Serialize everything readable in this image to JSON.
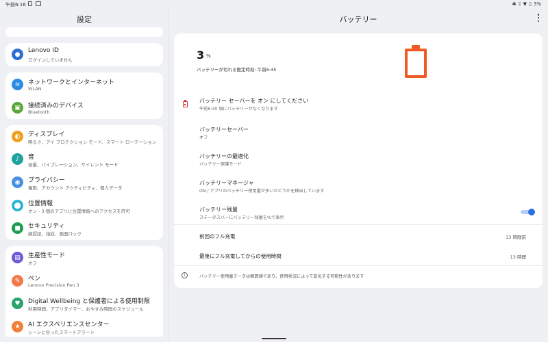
{
  "status_bar": {
    "time": "午前6:16",
    "battery": "3%"
  },
  "settings": {
    "title": "設定",
    "groups": [
      {
        "items": [
          {
            "title": "Lenovo ID",
            "subtitle": "ログインしていません",
            "icon": "person-icon",
            "color": "#2c6fd1"
          }
        ]
      },
      {
        "items": [
          {
            "title": "ネットワークとインターネット",
            "subtitle": "WLAN",
            "icon": "wifi-icon",
            "color": "#2d8ae3"
          },
          {
            "title": "接続済みのデバイス",
            "subtitle": "Bluetooth",
            "icon": "devices-icon",
            "color": "#5aa63a"
          }
        ]
      },
      {
        "items": [
          {
            "title": "ディスプレイ",
            "subtitle": "明るさ、アイ プロテクション モード、スマート ローテーション",
            "icon": "display-icon",
            "color": "#f0a020"
          },
          {
            "title": "音",
            "subtitle": "音量、バイブレーション、サイレント モード",
            "icon": "sound-icon",
            "color": "#1fa39b"
          },
          {
            "title": "プライバシー",
            "subtitle": "権限、アカウント アクティビティ、個人データ",
            "icon": "privacy-icon",
            "color": "#4a90e2"
          },
          {
            "title": "位置情報",
            "subtitle": "オン - 3 個のアプリに位置情報へのアクセスを許可",
            "icon": "location-icon",
            "color": "#2bb3d6"
          },
          {
            "title": "セキュリティ",
            "subtitle": "顔認証、指紋、画面ロック",
            "icon": "lock-icon",
            "color": "#1e9c55"
          }
        ]
      },
      {
        "items": [
          {
            "title": "生産性モード",
            "subtitle": "オフ",
            "icon": "productivity-icon",
            "color": "#6b5bd6"
          },
          {
            "title": "ペン",
            "subtitle": "Lenovo Precision Pen 3",
            "icon": "pen-icon",
            "color": "#f07a4a"
          },
          {
            "title": "Digital Wellbeing と保護者による使用制限",
            "subtitle": "利用時間、アプリタイマー、おやすみ時間のスケジュール",
            "icon": "wellbeing-icon",
            "color": "#2ba36a"
          },
          {
            "title": "AI エクスペリエンスセンター",
            "subtitle": "シーンに合ったスマートアラート",
            "icon": "ai-star-icon",
            "color": "#f0803a"
          }
        ]
      }
    ]
  },
  "battery": {
    "title": "バッテリー",
    "percent": "3",
    "percent_unit": "%",
    "estimate": "バッテリーが切れる推定時刻: 午前6:45",
    "level": 0.03,
    "accent_color": "#f15a24",
    "saver_prompt": {
      "title": "バッテリー セーバーを オン にしてください",
      "subtitle": "午前6:30 頃にバッテリーがなくなります"
    },
    "rows": [
      {
        "title": "バッテリーセーバー",
        "subtitle": "オフ"
      },
      {
        "title": "バッテリーの最適化",
        "subtitle": "バッテリー保護モード"
      },
      {
        "title": "バッテリーマネージャ",
        "subtitle": "ON / アプリのバッテリー使用量が多いかどうかを検出しています"
      }
    ],
    "percentage_toggle": {
      "title": "バッテリー残量",
      "subtitle": "ステータスバーにバッテリー残量を%で表示",
      "on": true
    },
    "stats": [
      {
        "label": "前回のフル充電",
        "value": "13 時間前"
      },
      {
        "label": "最後にフル充電してからの使用時間",
        "value": "13 時間"
      }
    ],
    "info": "バッテリー使用量データは概算値であり、使用状況によって変化する可能性があります"
  }
}
